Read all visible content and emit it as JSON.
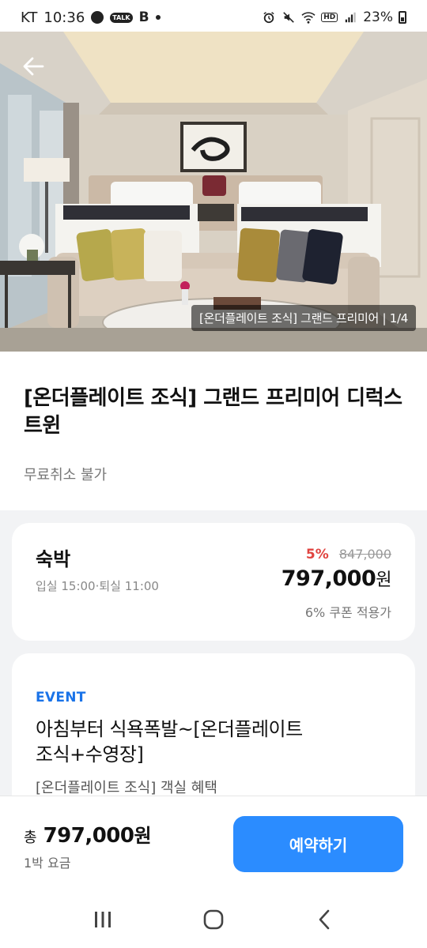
{
  "status_bar": {
    "carrier": "KT",
    "time": "10:36",
    "notification_b": "B",
    "talk_badge": "TALK",
    "battery": "23%",
    "hd_badge": "HD"
  },
  "hero": {
    "image_counter": "[온더플레이트 조식] 그랜드 프리미어 | 1/4"
  },
  "room": {
    "title": "[온더플레이트 조식] 그랜드 프리미어 디럭스 트윈",
    "cancel_policy": "무료취소 불가"
  },
  "price_card": {
    "label": "숙박",
    "checkin_checkout": "입실 15:00·퇴실 11:00",
    "discount_rate": "5%",
    "original_price": "847,000",
    "final_price": "797,000",
    "currency_unit": "원",
    "coupon_text": "6% 쿠폰 적용가"
  },
  "event": {
    "tag": "EVENT",
    "title_line1": "아침부터 식욕폭발~[온더플레이트",
    "title_line2": "조식+수영장]",
    "description": "[온더플레이트 조식] 객실 혜택"
  },
  "bottom_bar": {
    "total_prefix": "총",
    "total_price": "797,000",
    "total_unit": "원",
    "per_night": "1박 요금",
    "reserve_label": "예약하기"
  },
  "colors": {
    "accent": "#2b8cff",
    "discount": "#e0433f",
    "event_tag": "#1a73e8"
  }
}
